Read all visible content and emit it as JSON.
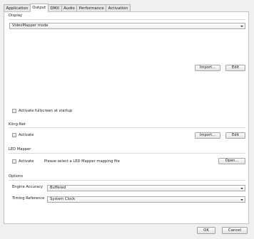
{
  "tabs": [
    {
      "label": "Application",
      "active": false
    },
    {
      "label": "Output",
      "active": true
    },
    {
      "label": "DMX",
      "active": false
    },
    {
      "label": "Audio",
      "active": false
    },
    {
      "label": "Performance",
      "active": false
    },
    {
      "label": "Activation",
      "active": false
    }
  ],
  "display": {
    "title": "Display",
    "mode_value": "VideoMapper mode",
    "import_label": "Import...",
    "edit_label": "Edit",
    "fullscreen_label": "Activate fullscreen at startup",
    "fullscreen_checked": false
  },
  "kling": {
    "title": "Kling-Net",
    "activate_label": "Activate",
    "activate_checked": false,
    "import_label": "Import...",
    "edit_label": "Edit"
  },
  "led": {
    "title": "LED Mapper",
    "activate_label": "Activate",
    "activate_checked": false,
    "message": "Please select a LED Mapper mapping file",
    "open_label": "Open..."
  },
  "options": {
    "title": "Options",
    "engine_label": "Engine Accuracy",
    "engine_value": "Buffered",
    "timing_label": "Timing Reference",
    "timing_value": "System Clock"
  },
  "dialog": {
    "ok_label": "OK",
    "cancel_label": "Cancel"
  }
}
